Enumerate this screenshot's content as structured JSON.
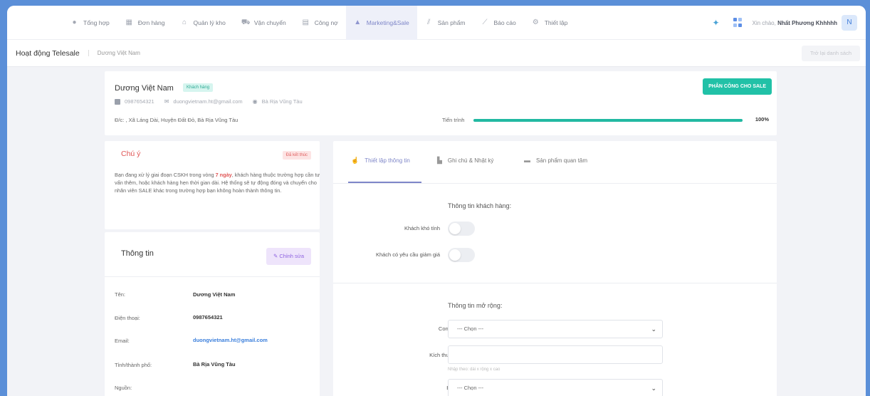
{
  "nav": {
    "items": [
      {
        "label": "Tổng hợp",
        "icon": "circle-icon"
      },
      {
        "label": "Đơn hàng",
        "icon": "calendar-icon"
      },
      {
        "label": "Quản lý kho",
        "icon": "warehouse-icon"
      },
      {
        "label": "Vận chuyển",
        "icon": "truck-icon"
      },
      {
        "label": "Công nợ",
        "icon": "wallet-icon"
      },
      {
        "label": "Marketing&Sale",
        "icon": "megaphone-icon"
      },
      {
        "label": "Sản phẩm",
        "icon": "box-icon"
      },
      {
        "label": "Báo cáo",
        "icon": "chart-icon"
      },
      {
        "label": "Thiết lập",
        "icon": "settings-icon"
      }
    ],
    "active": "Marketing&Sale",
    "greeting": "Xin chào,",
    "user_name": "Nhất Phương Khhhhh",
    "avatar_letter": "N"
  },
  "subheader": {
    "title": "Hoạt động Telesale",
    "breadcrumb": "Dương Việt Nam",
    "back_label": "Trở lại danh sách"
  },
  "customer": {
    "name": "Dương Việt Nam",
    "badge": "Khách hàng",
    "phone": "0987654321",
    "email": "duongvietnam.ht@gmail.com",
    "province": "Bà Rịa Vũng Tàu",
    "address": "Đ/c: , Xã Láng Dài, Huyện Đất Đỏ, Bà Rịa Vũng Tàu",
    "assign_label": "PHÂN CÔNG CHO SALE",
    "progress_label": "Tiến trình",
    "progress_value": "100%",
    "progress_fraction": 1.0
  },
  "note": {
    "title": "Chú ý",
    "badge": "Đã kết thúc",
    "body_pre": "Bạn đang xử lý giai đoạn CSKH trong vòng ",
    "body_bold": "7 ngày",
    "body_post": ", khách hàng thuộc trường hợp cần tư vấn thêm, hoặc khách hàng hẹn thời gian dài. Hệ thống sẽ tự động đóng và chuyển cho nhân viên SALE khác trong trường hợp bạn không hoàn thành thông tin."
  },
  "info": {
    "title": "Thông tin",
    "edit_label": "Chỉnh sửa",
    "rows": [
      {
        "label": "Tên:",
        "value": "Dương Việt Nam"
      },
      {
        "label": "Điện thoại:",
        "value": "0987654321"
      },
      {
        "label": "Email:",
        "value": "duongvietnam.ht@gmail.com"
      },
      {
        "label": "Tỉnh/thành phố:",
        "value": "Bà Rịa Vũng Tàu"
      },
      {
        "label": "Nguồn:",
        "value": ""
      }
    ]
  },
  "tabs": [
    {
      "label": "Thiết lập thông tin",
      "icon": "hand-icon"
    },
    {
      "label": "Ghi chú & Nhật ký",
      "icon": "note-icon"
    },
    {
      "label": "Sản phẩm quan tâm",
      "icon": "product-icon"
    }
  ],
  "form": {
    "section1_title": "Thông tin khách hàng:",
    "toggle1_label": "Khách khó tính",
    "toggle2_label": "Khách có yêu cầu giảm giá",
    "section2_title": "Thông tin mở rộng:",
    "field1_label": "Con trưởng/thứ",
    "field1_value": "--- Chọn ---",
    "field2_label": "Kích thước bàn thờ",
    "field2_value": "",
    "field2_hint": "Nhập theo: dài x rộng x cao",
    "field3_label": "Bàn thờ cho",
    "field3_value": "--- Chọn ---"
  },
  "colors": {
    "accent": "#21c1a7",
    "active_nav": "#7e86c8",
    "danger": "#e05555",
    "edit": "#8e62e0",
    "link": "#3b7fdc"
  }
}
